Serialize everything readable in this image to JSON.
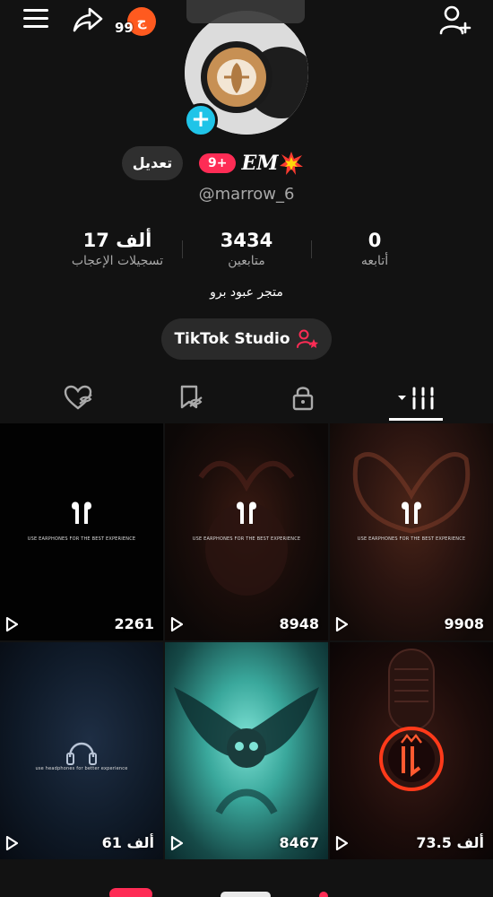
{
  "header": {
    "notif_glyph": "ج",
    "notif_count": "99"
  },
  "profile": {
    "edit_label": "تعديل",
    "badge": "9+",
    "display_name": "EM",
    "username": "@marrow_6"
  },
  "stats": [
    {
      "value": "17 ألف",
      "label": "تسجيلات الإعجاب"
    },
    {
      "value": "3434",
      "label": "متابعين"
    },
    {
      "value": "0",
      "label": "أتابعه"
    }
  ],
  "bio": "متجر عبود برو",
  "studio_label": "TikTok Studio",
  "videos": [
    {
      "views": "2261",
      "caption": "USE EARPHONES FOR THE BEST EXPERIENCE"
    },
    {
      "views": "8948",
      "caption": "USE EARPHONES FOR THE BEST EXPERIENCE"
    },
    {
      "views": "9908",
      "caption": "USE EARPHONES FOR THE BEST EXPERIENCE"
    },
    {
      "views": "61 ألف",
      "caption": "use headphones for better experience"
    },
    {
      "views": "8467",
      "caption": ""
    },
    {
      "views": "73.5 ألف",
      "caption": ""
    }
  ],
  "colors": {
    "accent": "#fe2c55",
    "cyan": "#20c4e8",
    "notif": "#ff5a1f"
  }
}
